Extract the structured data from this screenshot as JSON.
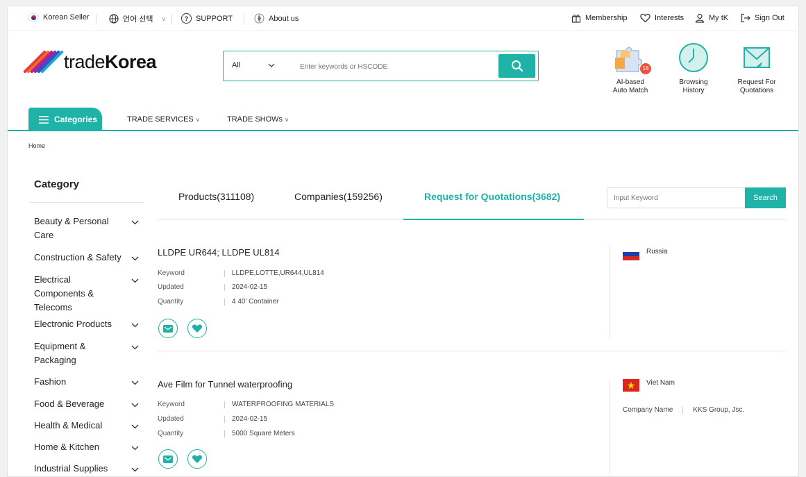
{
  "topbar": {
    "left": [
      {
        "label": "Korean Seller",
        "icon": "korea-flag-icon"
      },
      {
        "label": "언어 선택",
        "icon": "globe-icon"
      },
      {
        "label": "SUPPORT",
        "icon": "question-icon"
      },
      {
        "label": "About us",
        "icon": "compass-icon"
      }
    ],
    "right": [
      {
        "label": "Membership",
        "icon": "gift-icon"
      },
      {
        "label": "Interests",
        "icon": "heart-icon"
      },
      {
        "label": "My tK",
        "icon": "user-icon"
      },
      {
        "label": "Sign Out",
        "icon": "sign-out-icon"
      }
    ]
  },
  "logo": {
    "prefix": "trade",
    "bold": "Korea"
  },
  "search": {
    "category": "All",
    "placeholder": "Enter keywords or HSCODE"
  },
  "header_icons": [
    {
      "line1": "AI-based",
      "line2": "Auto Match",
      "badge": "18"
    },
    {
      "line1": "Browsing",
      "line2": "History"
    },
    {
      "line1": "Request For",
      "line2": "Quotations"
    }
  ],
  "nav": {
    "categories": "Categories",
    "links": [
      "TRADE SERVICES",
      "TRADE SHOWs"
    ]
  },
  "breadcrumb": "Home",
  "sidebar": {
    "title": "Category",
    "items": [
      {
        "label": "Beauty & Personal Care"
      },
      {
        "label": "Construction & Safety"
      },
      {
        "label": "Electrical Components & Telecoms"
      },
      {
        "label": "Electronic Products"
      },
      {
        "label": "Equipment & Packaging"
      },
      {
        "label": "Fashion"
      },
      {
        "label": "Food & Beverage"
      },
      {
        "label": "Health & Medical"
      },
      {
        "label": "Home & Kitchen"
      },
      {
        "label": "Industrial Supplies"
      }
    ]
  },
  "tabs": [
    {
      "label": "Products(311108)"
    },
    {
      "label": "Companies(159256)"
    },
    {
      "label": "Request for Quotations(3682)",
      "active": true
    }
  ],
  "keyword_search": {
    "placeholder": "Input Keyword",
    "button": "Search"
  },
  "labels": {
    "keyword": "Keyword",
    "updated": "Updated",
    "quantity": "Quantity",
    "company_name": "Company Name"
  },
  "rfqs": [
    {
      "title": "LLDPE UR644; LLDPE UL814",
      "keyword": "LLDPE,LOTTE,UR644,UL814",
      "updated": "2024-02-15",
      "quantity": "4 40' Container",
      "country": "Russia"
    },
    {
      "title": "Ave Film for Tunnel waterproofing",
      "keyword": "WATERPROOFING MATERIALS",
      "updated": "2024-02-15",
      "quantity": "5000 Square Meters",
      "country": "Viet Nam",
      "company": "KKS Group, Jsc."
    }
  ],
  "colors": {
    "accent": "#1fb3a8",
    "border": "#e5e5e5"
  }
}
